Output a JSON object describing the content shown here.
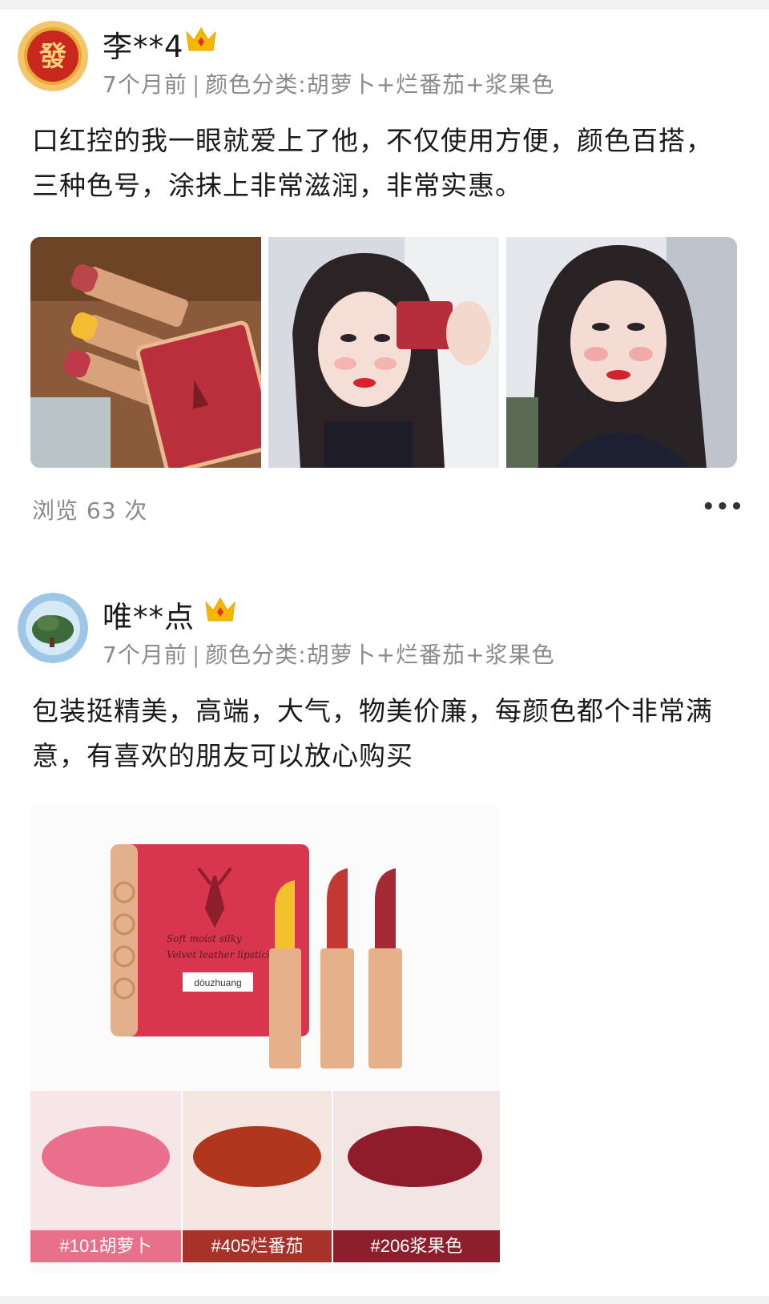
{
  "reviews": [
    {
      "username": "李**4",
      "time": "7个月前",
      "separator": "|",
      "variant": "颜色分类:胡萝卜+烂番茄+浆果色",
      "content": "口红控的我一眼就爱上了他，不仅使用方便，颜色百搭，三种色号，涂抹上非常滋润，非常实惠。",
      "views": "浏览 63 次",
      "more": "•••"
    },
    {
      "username": "唯**点",
      "time": "7个月前",
      "separator": "|",
      "variant": "颜色分类:胡萝卜+烂番茄+浆果色",
      "content": "包装挺精美，高端，大气，物美价廉，每颜色都个非常满意，有喜欢的朋友可以放心购买"
    }
  ],
  "product_image": {
    "script_line1": "Soft moist silky",
    "script_line2": "Velvet leather lipstick",
    "brand": "dòuzhuang",
    "swatches": [
      {
        "label": "#101胡萝卜",
        "color": "#e9708a"
      },
      {
        "label": "#405烂番茄",
        "color": "#a7322a"
      },
      {
        "label": "#206浆果色",
        "color": "#8c1f2b"
      }
    ]
  },
  "colors": {
    "accent_crown": "#f5b800",
    "meta_gray": "#8a8a8a"
  }
}
